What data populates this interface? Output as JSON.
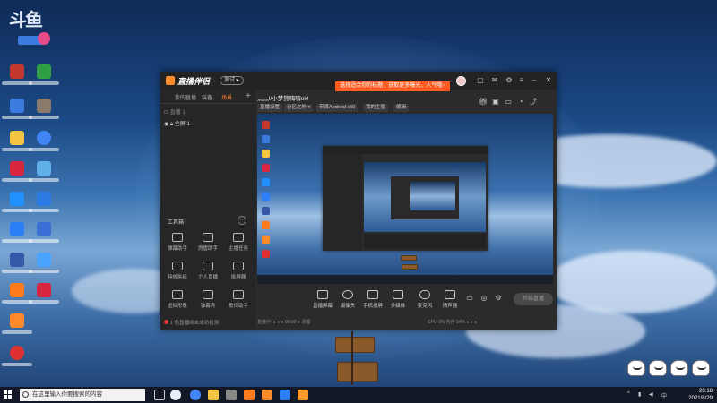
{
  "desktop": {
    "logo_mark": "斗鱼",
    "icons": [
      {
        "color": "#c0392b"
      },
      {
        "color": "#2ea043"
      },
      {
        "color": "#3b7be0"
      },
      {
        "color": "#8a7b6b"
      },
      {
        "color": "#f4c542"
      },
      {
        "color": "#4285f4"
      },
      {
        "color": "#d7263d"
      },
      {
        "color": "#5fb0e6"
      },
      {
        "color": "#1e90ff"
      },
      {
        "color": "#2c7be5"
      },
      {
        "color": "#2d7ff9"
      },
      {
        "color": "#3b6fd6"
      },
      {
        "color": "#3558a8"
      },
      {
        "color": "#4aa3ff"
      },
      {
        "color": "#ff7a1a"
      },
      {
        "color": "#d7263d"
      },
      {
        "color": "#ff8a2a"
      },
      {
        "color": "#e03131"
      }
    ]
  },
  "window": {
    "app_name": "直播伴侣",
    "version_badge": "测试 ▸",
    "notice": "选择适合你的标题，获取更多曝光，人气哦~",
    "left_tabs": [
      "我的直播",
      "装备",
      "场景"
    ],
    "scene_header": "⊡ 直播 1",
    "scene_item": "全屏 1",
    "tools_header": "工具箱",
    "tools": [
      {
        "label": "弹幕助手"
      },
      {
        "label": "房管助手"
      },
      {
        "label": "主播任务"
      },
      {
        "label": "特效贴纸"
      },
      {
        "label": "个人直播"
      },
      {
        "label": "投屏器"
      },
      {
        "label": "虚拟形象"
      },
      {
        "label": "弹幕秀"
      },
      {
        "label": "歌词助手"
      },
      {
        "label": "美颜"
      },
      {
        "label": "设置"
      },
      {
        "label": "画中画"
      }
    ],
    "left_status": "1 色直播间未成功检测",
    "room_title": "灬灬l/小梦熊嗨嗨ok!",
    "chips": [
      "直播设置",
      "分区之外 ▾",
      "带货Android x60",
      "我的主播",
      "编辑"
    ],
    "bottom_controls": [
      {
        "label": "直播屏幕"
      },
      {
        "label": "摄像头"
      },
      {
        "label": "手机投屏"
      },
      {
        "label": "多媒体"
      },
      {
        "label": "麦克风"
      },
      {
        "label": "扬声器"
      }
    ],
    "start_label": "开始直播",
    "status_left": "直播中: ● ●  ● 00:00  ● 清理",
    "status_right": "CPU 0%   内存 34%   ● ● ●"
  },
  "taskbar": {
    "search_placeholder": "在这里输入你要搜索的内容",
    "time": "20:18",
    "date": "2021/8/29"
  }
}
